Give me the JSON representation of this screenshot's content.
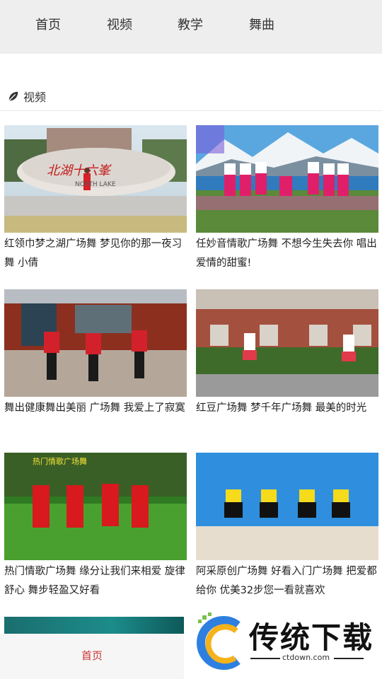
{
  "nav": {
    "tabs": [
      "首页",
      "视频",
      "教学",
      "舞曲"
    ]
  },
  "section": {
    "icon": "leaf-icon",
    "title": "视频"
  },
  "videos": [
    {
      "title": "红领巾梦之湖广场舞 梦见你的那一夜习舞 小倩",
      "thumb_sign": "北湖十六峯",
      "thumb_sign_small": "NORTH LAKE"
    },
    {
      "title": "任妙音情歌广场舞 不想今生失去你 唱出爱情的甜蜜!"
    },
    {
      "title": "舞出健康舞出美丽 广场舞 我爱上了寂寞"
    },
    {
      "title": "红豆广场舞 梦千年广场舞 最美的时光"
    },
    {
      "title": "热门情歌广场舞 缘分让我们来相爱 旋律舒心 舞步轻盈又好看",
      "thumb_sign": "热门情歌广场舞"
    },
    {
      "title": "阿采原创广场舞 好看入门广场舞 把爱都给你 优美32步您一看就喜欢"
    }
  ],
  "bottom_nav": {
    "home_label": "首页"
  },
  "watermark": {
    "text": "传统下载",
    "url": "ctdown.com"
  },
  "colors": {
    "nav_bg": "#eeeeee",
    "accent_red": "#cc3333"
  }
}
